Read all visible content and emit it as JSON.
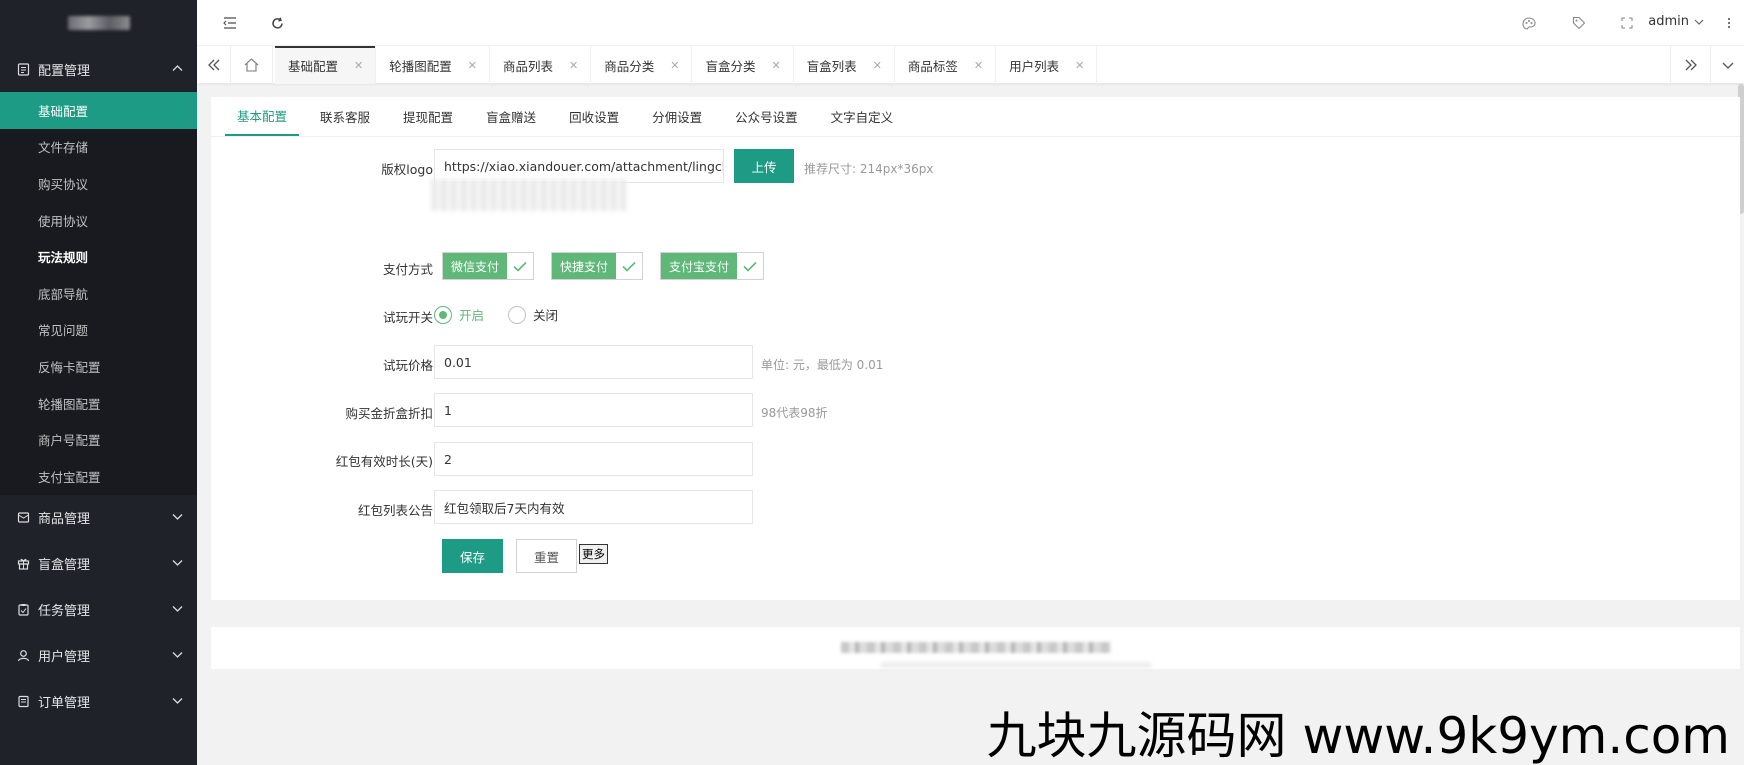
{
  "sidebar": {
    "groups": [
      {
        "label": "配置管理",
        "icon": "config-icon",
        "expanded": true
      },
      {
        "label": "商品管理",
        "icon": "goods-icon"
      },
      {
        "label": "盲盒管理",
        "icon": "gift-icon"
      },
      {
        "label": "任务管理",
        "icon": "task-icon"
      },
      {
        "label": "用户管理",
        "icon": "user-icon"
      },
      {
        "label": "订单管理",
        "icon": "order-icon"
      }
    ],
    "config_items": [
      "基础配置",
      "文件存储",
      "购买协议",
      "使用协议",
      "玩法规则",
      "底部导航",
      "常见问题",
      "反悔卡配置",
      "轮播图配置",
      "商户号配置",
      "支付宝配置"
    ]
  },
  "header": {
    "user": "admin"
  },
  "tabs": [
    "基础配置",
    "轮播图配置",
    "商品列表",
    "商品分类",
    "盲盒分类",
    "盲盒列表",
    "商品标签",
    "用户列表"
  ],
  "inner_tabs": [
    "基本配置",
    "联系客服",
    "提现配置",
    "盲盒赠送",
    "回收设置",
    "分佣设置",
    "公众号设置",
    "文字自定义"
  ],
  "form": {
    "logo": {
      "label": "版权logo",
      "value": "https://xiao.xiandouer.com/attachment/lingchi_blin",
      "button": "上传",
      "hint": "推荐尺寸: 214px*36px"
    },
    "pay": {
      "label": "支付方式",
      "options": [
        "微信支付",
        "快捷支付",
        "支付宝支付"
      ]
    },
    "trial_switch": {
      "label": "试玩开关",
      "on": "开启",
      "off": "关闭",
      "selected": "开启"
    },
    "trial_price": {
      "label": "试玩价格",
      "value": "0.01",
      "hint": "单位: 元，最低为 0.01"
    },
    "discount": {
      "label": "购买金折盒折扣",
      "value": "1",
      "hint": "98代表98折"
    },
    "redpack_days": {
      "label": "红包有效时长(天)",
      "value": "2"
    },
    "redpack_notice": {
      "label": "红包列表公告",
      "value": "红包领取后7天内有效"
    },
    "save": "保存",
    "reset": "重置",
    "more": "更多"
  },
  "watermark": "九块九源码网 www.9k9ym.com",
  "colors": {
    "primary": "#1e9b85",
    "checkbox": "#5fb878",
    "sidebar": "#20222a"
  }
}
